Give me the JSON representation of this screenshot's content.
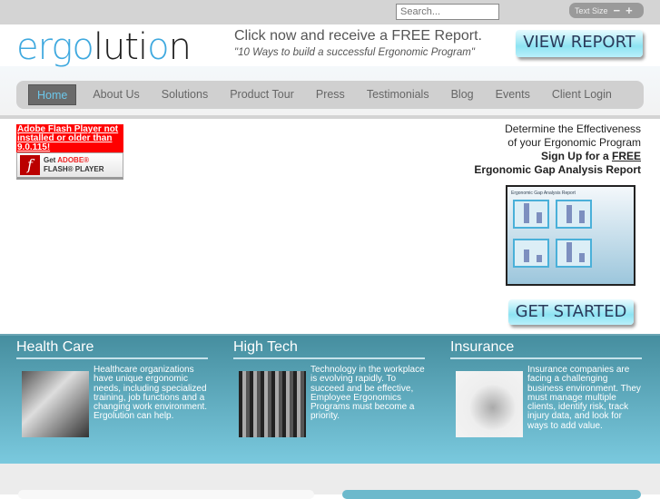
{
  "topbar": {
    "search_placeholder": "Search...",
    "text_size_label": "Text Size",
    "minus": "−",
    "plus": "+"
  },
  "header": {
    "logo": "ergolution",
    "logo_parts": [
      "ergo",
      "luti",
      "o",
      "n"
    ],
    "promo_line1": "Click now and receive a FREE Report.",
    "promo_line2": "\"10 Ways to build a successful Ergonomic Program\"",
    "view_report": "VIEW REPORT"
  },
  "nav": {
    "items": [
      {
        "label": "Home",
        "active": true
      },
      {
        "label": "About Us"
      },
      {
        "label": "Solutions"
      },
      {
        "label": "Product Tour"
      },
      {
        "label": "Press"
      },
      {
        "label": "Testimonials"
      },
      {
        "label": "Blog"
      },
      {
        "label": "Events"
      },
      {
        "label": "Client Login"
      }
    ]
  },
  "flash": {
    "warning": "Adobe Flash Player not installed or older than 9.0.115!",
    "get": "Get",
    "adobe": "ADOBE®",
    "player": "FLASH® PLAYER"
  },
  "cta": {
    "line1": "Determine the Effectiveness",
    "line2": "of your Ergonomic Program",
    "line3": "Sign Up for a",
    "free": "FREE",
    "line4": "Ergonomic Gap Analysis Report",
    "report_thumb_title": "Ergonomic Gap Analysis Report",
    "get_started": "GET STARTED"
  },
  "sections": [
    {
      "title": "Health Care",
      "text": "Healthcare organizations have unique ergonomic needs, including specialized training, job functions and a changing work environment. Ergolution can help."
    },
    {
      "title": "High Tech",
      "text": "Technology in the workplace is evolving rapidly. To succeed and be effective, Employee Ergonomics Programs must become a priority."
    },
    {
      "title": "Insurance",
      "text": "Insurance companies are facing a challenging business environment. They must manage multiple clients, identify risk, track injury data, and look for ways to add value."
    }
  ]
}
